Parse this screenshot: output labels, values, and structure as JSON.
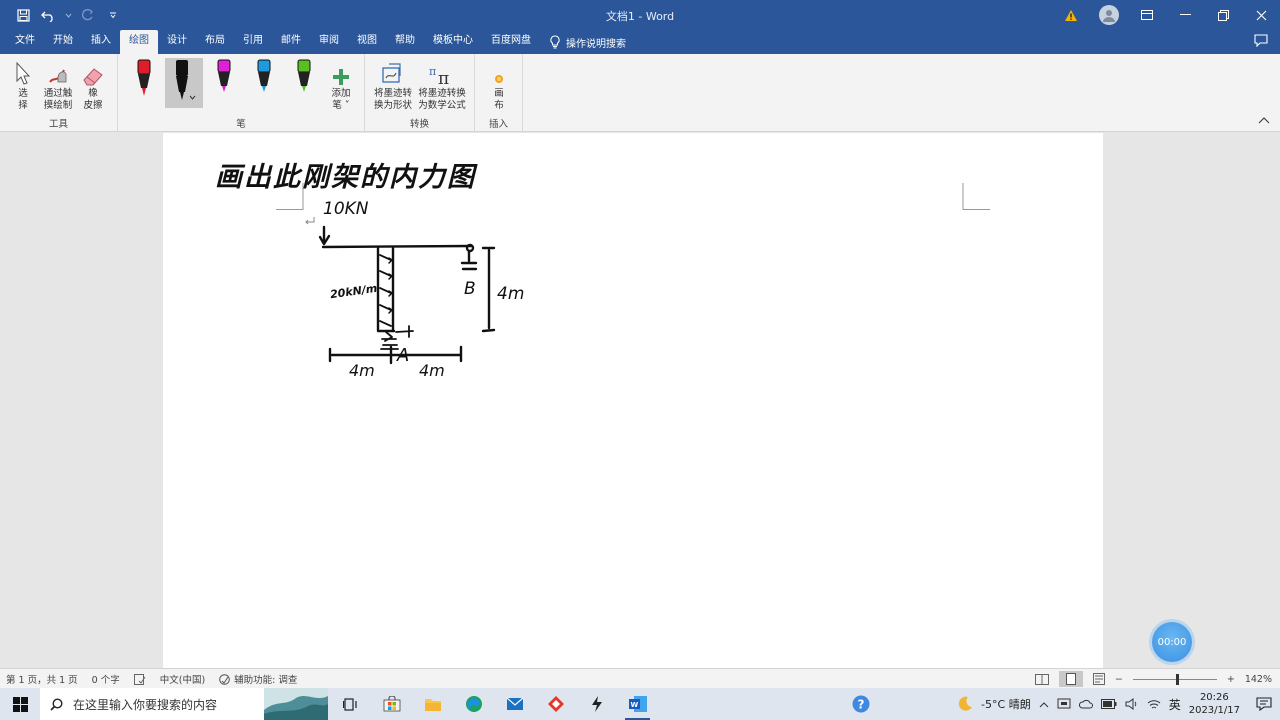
{
  "titlebar": {
    "title": "文档1  -  Word",
    "bg_color": "#2b579a"
  },
  "menu": {
    "tabs": [
      "文件",
      "开始",
      "插入",
      "绘图",
      "设计",
      "布局",
      "引用",
      "邮件",
      "审阅",
      "视图",
      "帮助",
      "模板中心",
      "百度网盘"
    ],
    "active_tab": "绘图",
    "search_label": "操作说明搜索"
  },
  "ribbon": {
    "tools_group": {
      "label": "工具",
      "select": "选\n择",
      "touch_draw": "通过触\n摸绘制",
      "eraser": "橡\n皮擦"
    },
    "pens_group": {
      "label": "笔",
      "pen_colors": [
        "#e11d2a",
        "#111111",
        "#e020d8",
        "#1e9be0",
        "#58c020"
      ],
      "add_pen": "添加\n笔 ˅"
    },
    "convert_group": {
      "label": "转换",
      "ink_to_shape": "将墨迹转\n换为形状",
      "ink_to_math": "将墨迹转换\n为数学公式"
    },
    "insert_group": {
      "label": "插入",
      "canvas": "画\n布"
    }
  },
  "document": {
    "handwritten_title": "画出此刚架的内力图",
    "load_label": "10KN",
    "dist_load_label": "20kN/m",
    "support_b": "B",
    "support_a": "A",
    "height_label": "4m",
    "span_left": "4m",
    "span_right": "4m"
  },
  "statusbar": {
    "page_info": "第 1 页，共 1 页",
    "word_count": "0 个字",
    "language": "中文(中国)",
    "accessibility": "辅助功能: 调查",
    "zoom": "142%",
    "zoom_fraction": 0.52
  },
  "timer": {
    "label": "00:00"
  },
  "taskbar": {
    "search_placeholder": "在这里输入你要搜索的内容",
    "weather": "-5°C  晴朗",
    "ime": "英",
    "time": "20:26",
    "date": "2023/1/17"
  }
}
